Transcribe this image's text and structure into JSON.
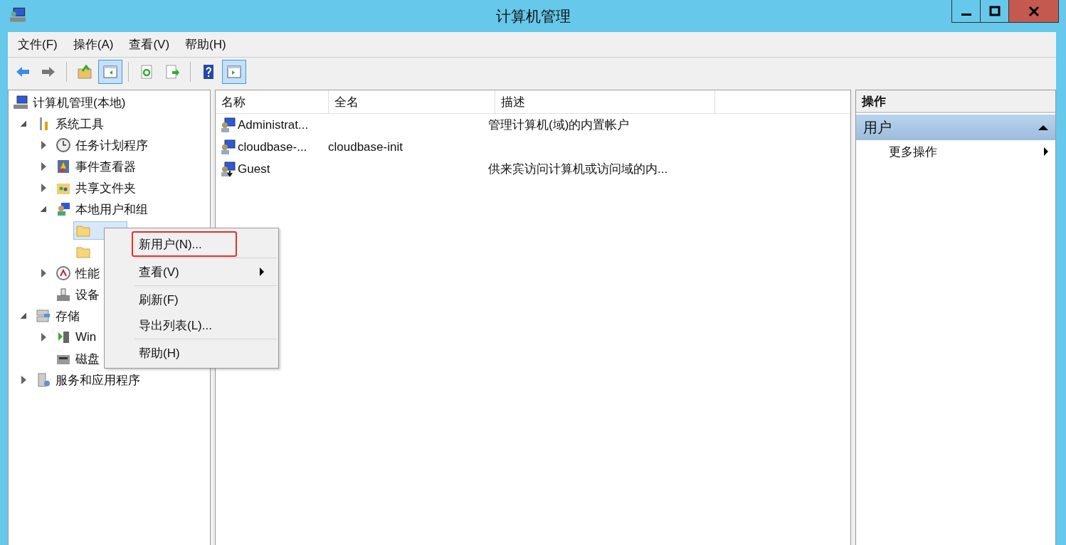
{
  "window": {
    "title": "计算机管理"
  },
  "menu_bar": [
    "文件(F)",
    "操作(A)",
    "查看(V)",
    "帮助(H)"
  ],
  "toolbar": [
    {
      "kind": "back",
      "pressed": false
    },
    {
      "kind": "forward",
      "pressed": false
    },
    {
      "kind": "separator"
    },
    {
      "kind": "up",
      "pressed": false
    },
    {
      "kind": "tree-pane",
      "pressed": true
    },
    {
      "kind": "separator"
    },
    {
      "kind": "refresh",
      "pressed": false
    },
    {
      "kind": "export",
      "pressed": false
    },
    {
      "kind": "separator"
    },
    {
      "kind": "help",
      "pressed": false
    },
    {
      "kind": "action-pane",
      "pressed": true
    }
  ],
  "tree": [
    {
      "label": "计算机管理(本地)",
      "kind": "computer",
      "selected": false,
      "children": [
        {
          "label": "系统工具",
          "kind": "tools",
          "selected": false,
          "expanded": true,
          "children": [
            {
              "label": "任务计划程序",
              "kind": "clock",
              "selected": false,
              "expanded": false
            },
            {
              "label": "事件查看器",
              "kind": "event",
              "selected": false,
              "expanded": false
            },
            {
              "label": "共享文件夹",
              "kind": "share",
              "selected": false,
              "expanded": false
            },
            {
              "label": "本地用户和组",
              "kind": "users",
              "selected": false,
              "expanded": true,
              "children": [
                {
                  "kind": "folder",
                  "selected": true
                },
                {
                  "kind": "folder",
                  "selected": false
                }
              ]
            },
            {
              "label": "性能",
              "kind": "perf",
              "selected": false,
              "expanded": false
            },
            {
              "label": "设备",
              "kind": "device",
              "selected": false
            }
          ]
        },
        {
          "label": "存储",
          "kind": "storage",
          "selected": false,
          "expanded": true,
          "children": [
            {
              "label": "Win",
              "kind": "backup",
              "selected": false,
              "expanded": false
            },
            {
              "label": "磁盘",
              "kind": "disk",
              "selected": false
            }
          ]
        },
        {
          "label": "服务和应用程序",
          "kind": "services",
          "selected": false,
          "expanded": false
        }
      ]
    }
  ],
  "list": {
    "columns": [
      "名称",
      "全名",
      "描述"
    ],
    "rows": [
      {
        "kind": "user",
        "cells": [
          "Administrat...",
          "",
          "管理计算机(域)的内置帐户"
        ]
      },
      {
        "kind": "user",
        "cells": [
          "cloudbase-...",
          "cloudbase-init",
          ""
        ]
      },
      {
        "kind": "guest",
        "cells": [
          "Guest",
          "",
          "供来宾访问计算机或访问域的内..."
        ]
      }
    ]
  },
  "actions": {
    "header": "操作",
    "section": {
      "label": "用户",
      "expanded": true
    },
    "items": [
      {
        "label": "更多操作",
        "submenu": true
      }
    ]
  },
  "context_menu": {
    "groups": [
      [
        {
          "label": "新用户(N)...",
          "submenu": false,
          "highlighted": true
        }
      ],
      [
        {
          "label": "查看(V)",
          "submenu": true,
          "highlighted": false
        }
      ],
      [
        {
          "label": "刷新(F)",
          "submenu": false,
          "highlighted": false
        },
        {
          "label": "导出列表(L)...",
          "submenu": false,
          "highlighted": false
        }
      ],
      [
        {
          "label": "帮助(H)",
          "submenu": false,
          "highlighted": false
        }
      ]
    ]
  }
}
